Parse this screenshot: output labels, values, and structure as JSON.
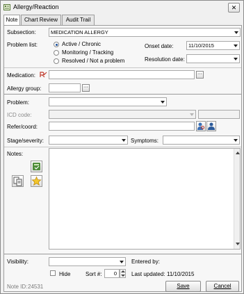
{
  "window": {
    "title": "Allergy/Reaction",
    "close_glyph": "✕"
  },
  "tabs": [
    {
      "label": "Note",
      "active": true
    },
    {
      "label": "Chart Review",
      "active": false
    },
    {
      "label": "Audit Trail",
      "active": false
    }
  ],
  "form": {
    "subsection_label": "Subsection:",
    "subsection_value": "MEDICATION ALLERGY",
    "problem_list_label": "Problem list:",
    "problem_options": [
      {
        "label": "Active / Chronic",
        "selected": true
      },
      {
        "label": "Monitoring / Tracking",
        "selected": false
      },
      {
        "label": "Resolved / Not a problem",
        "selected": false
      }
    ],
    "onset_label": "Onset date:",
    "onset_value": "11/10/2015",
    "resolution_label": "Resolution date:",
    "resolution_value": "",
    "medication_label": "Medication:",
    "medication_value": "",
    "allergy_group_label": "Allergy group:",
    "allergy_group_value": "",
    "problem_label": "Problem:",
    "problem_value": "",
    "icd_label": "ICD code:",
    "icd_value": "",
    "refer_label": "Refer/coord:",
    "refer_value": "",
    "stage_label": "Stage/severity:",
    "stage_value": "",
    "symptoms_label": "Symptoms:",
    "symptoms_value": "",
    "notes_label": "Notes:",
    "notes_value": "",
    "browse_glyph": "···"
  },
  "footer": {
    "visibility_label": "Visibility:",
    "visibility_value": "",
    "entered_by_label": "Entered by:",
    "entered_by_value": "",
    "hide_label": "Hide",
    "hide_checked": false,
    "sort_label": "Sort #:",
    "sort_value": "0",
    "last_updated_label": "Last updated:",
    "last_updated_value": "11/10/2015",
    "note_id_label": "Note ID:",
    "note_id_value": "24531",
    "save_label": "Save",
    "cancel_label": "Cancel"
  },
  "colors": {
    "accent": "#1a4f9c",
    "rx_icon": "#c0392b",
    "panel": "#f7f7f7"
  },
  "icons": [
    "window-icon",
    "rx-icon",
    "search-person-icon",
    "person-icon",
    "book-icon",
    "copy-icon",
    "star-icon"
  ]
}
